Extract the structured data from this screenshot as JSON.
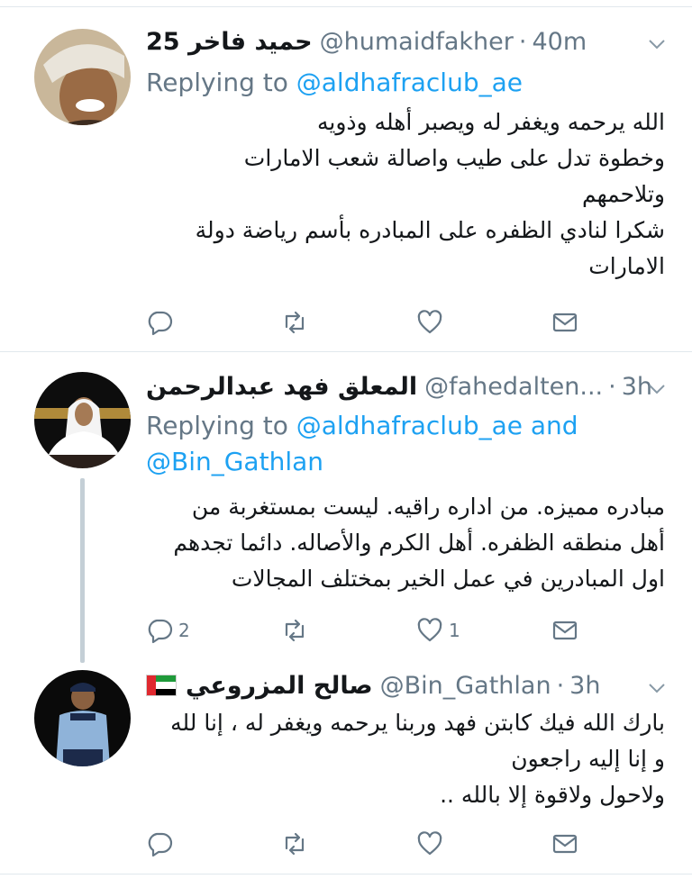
{
  "tweets": [
    {
      "name": "حميد فاخر 25",
      "handle": "@humaidfakher",
      "time": "40m",
      "replying_prefix": "Replying to ",
      "replying_mentions": "@aldhafraclub_ae",
      "body_lines": [
        "الله يرحمه ويغفر له ويصبر أهله وذويه",
        "وخطوة تدل على طيب واصالة شعب الامارات",
        "وتلاحمهم",
        "شكرا لنادي الظفره على المبادره بأسم رياضة دولة",
        "الامارات"
      ],
      "reply_count": "",
      "like_count": ""
    },
    {
      "name": "المعلق فهد عبدالرحمن",
      "handle": "@fahedalten...",
      "time": "3h",
      "replying_prefix": "Replying to ",
      "replying_mentions": "@aldhafraclub_ae and",
      "replying_mentions_2": "@Bin_Gathlan",
      "body_lines": [
        "مبادره مميزه. من اداره راقيه. ليست بمستغربة من",
        "أهل منطقه الظفره. أهل الكرم والأصاله. دائما تجدهم",
        "اول المبادرين في عمل الخير بمختلف المجالات"
      ],
      "reply_count": "2",
      "like_count": "1"
    },
    {
      "name": "صالح المزروعي",
      "handle": "@Bin_Gathlan",
      "time": "3h",
      "body_lines": [
        "بارك الله فيك كابتن فهد وربنا يرحمه ويغفر له ، إنا لله",
        "و إنا إليه راجعون",
        "ولاحول ولاقوة إلا بالله .."
      ],
      "reply_count": "",
      "like_count": ""
    }
  ],
  "colors": {
    "link": "#1da1f2",
    "muted": "#657786",
    "divider": "#e1e8ed",
    "thread": "#c4cfd6"
  },
  "icons": [
    "reply-icon",
    "retweet-icon",
    "like-icon",
    "dm-icon",
    "chevron-down-icon",
    "uae-flag-icon"
  ]
}
